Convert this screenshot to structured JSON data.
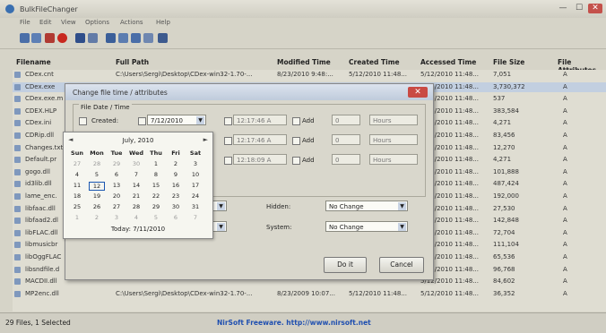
{
  "app": {
    "title": "BulkFileChanger"
  },
  "window_controls": {
    "min": "—",
    "max": "☐",
    "close": "✕"
  },
  "menu": [
    "File",
    "Edit",
    "View",
    "Options",
    "Actions",
    "Help"
  ],
  "toolbar_icons": [
    "open-icon",
    "save-icon",
    "delete-icon",
    "stop-icon",
    "properties-icon",
    "folder-icon",
    "copy-icon",
    "export-icon",
    "add-icon",
    "html-icon",
    "find-icon"
  ],
  "columns": [
    "Filename",
    "Full Path",
    "Modified Time",
    "Created Time",
    "Accessed Time",
    "File Size",
    "File Attributes"
  ],
  "rows": [
    [
      "CDex.cnt",
      "C:\\Users\\Sergi\\Desktop\\CDex-win32-1.70-...",
      "8/23/2010 9:48:...",
      "5/12/2010 11:48...",
      "5/12/2010 11:48...",
      "7,051",
      "A"
    ],
    [
      "CDex.exe",
      "C:\\Users\\Sergi\\Desktop\\CDex-win32-1.70-...",
      "",
      "",
      "5/12/2010 11:48...",
      "3,730,372",
      "A"
    ],
    [
      "CDex.exe.m",
      "",
      "",
      "",
      "5/12/2010 11:48...",
      "537",
      "A"
    ],
    [
      "CDEX.HLP",
      "",
      "",
      "",
      "5/12/2010 11:48...",
      "383,584",
      "A"
    ],
    [
      "CDex.ini",
      "",
      "",
      "",
      "5/12/2010 11:48...",
      "4,271",
      "A"
    ],
    [
      "CDRip.dll",
      "",
      "",
      "",
      "5/12/2010 11:48...",
      "83,456",
      "A"
    ],
    [
      "Changes.txt",
      "",
      "",
      "",
      "5/12/2010 11:48...",
      "12,270",
      "A"
    ],
    [
      "Default.pr",
      "",
      "",
      "",
      "5/12/2010 11:48...",
      "4,271",
      "A"
    ],
    [
      "gogo.dll",
      "",
      "",
      "",
      "5/12/2010 11:48...",
      "101,888",
      "A"
    ],
    [
      "id3lib.dll",
      "",
      "",
      "",
      "5/12/2010 11:48...",
      "487,424",
      "A"
    ],
    [
      "lame_enc.",
      "",
      "",
      "",
      "5/12/2010 11:48...",
      "192,000",
      "A"
    ],
    [
      "libfaac.dll",
      "",
      "",
      "",
      "5/12/2010 11:48...",
      "27,530",
      "A"
    ],
    [
      "libfaad2.dl",
      "",
      "",
      "",
      "5/12/2010 11:48...",
      "142,848",
      "A"
    ],
    [
      "libFLAC.dll",
      "",
      "",
      "",
      "5/12/2010 11:48...",
      "72,704",
      "A"
    ],
    [
      "libmusicbr",
      "",
      "",
      "",
      "5/12/2010 11:48...",
      "111,104",
      "A"
    ],
    [
      "libOggFLAC",
      "",
      "",
      "",
      "5/12/2010 11:48...",
      "65,536",
      "A"
    ],
    [
      "libsndfile.d",
      "",
      "",
      "",
      "5/12/2010 11:48...",
      "96,768",
      "A"
    ],
    [
      "MACDII.dll",
      "",
      "",
      "",
      "5/12/2010 11:48...",
      "84,602",
      "A"
    ],
    [
      "MP2enc.dll",
      "C:\\Users\\Sergi\\Desktop\\CDex-win32-1.70-...",
      "8/23/2009 10:07...",
      "5/12/2010 11:48...",
      "5/12/2010 11:48...",
      "36,352",
      "A"
    ]
  ],
  "status": {
    "left": "29 Files, 1 Selected",
    "center": "NirSoft Freeware.  http://www.nirsoft.net"
  },
  "dialog": {
    "title": "Change file time / attributes",
    "group_label": "File Date / Time",
    "created_label": "Created:",
    "created_date": "7/12/2010",
    "time_values": [
      "12:17:46 A",
      "12:17:46 A",
      "12:18:09 A"
    ],
    "add_label": "Add",
    "add_values": [
      "0",
      "0",
      "0"
    ],
    "unit_values": [
      "Hours",
      "Hours",
      "Hours"
    ],
    "hidden_label": "Hidden:",
    "system_label": "System:",
    "attr_values": [
      "No Change",
      "No Change"
    ],
    "ok": "Do it",
    "cancel": "Cancel",
    "close": "✕"
  },
  "calendar": {
    "month": "July, 2010",
    "prev": "◄",
    "next": "►",
    "weekdays": [
      "Sun",
      "Mon",
      "Tue",
      "Wed",
      "Thu",
      "Fri",
      "Sat"
    ],
    "weeks": [
      [
        "27",
        "28",
        "29",
        "30",
        "1",
        "2",
        "3"
      ],
      [
        "4",
        "5",
        "6",
        "7",
        "8",
        "9",
        "10"
      ],
      [
        "11",
        "12",
        "13",
        "14",
        "15",
        "16",
        "17"
      ],
      [
        "18",
        "19",
        "20",
        "21",
        "22",
        "23",
        "24"
      ],
      [
        "25",
        "26",
        "27",
        "28",
        "29",
        "30",
        "31"
      ],
      [
        "1",
        "2",
        "3",
        "4",
        "5",
        "6",
        "7"
      ]
    ],
    "today": "Today: 7/11/2010"
  },
  "colors": {
    "accent": "#1a56b0",
    "close": "#c94a43",
    "selection": "#c2cfe0"
  }
}
